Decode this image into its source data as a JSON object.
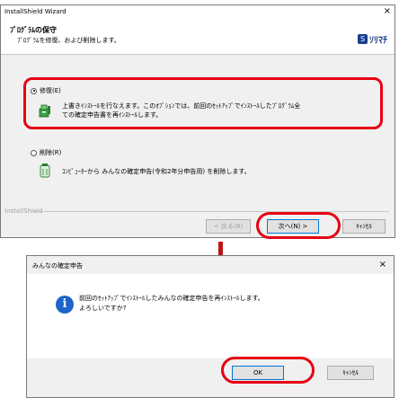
{
  "wizard": {
    "title": "InstallShield Wizard",
    "close_glyph": "×",
    "header_title": "ﾌﾟﾛｸﾞﾗﾑの保守",
    "header_subtitle": "ﾌﾟﾛｸﾞﾗﾑを修復、および削除します。",
    "logo_mark": "S",
    "logo_text": "ｿﾘﾏﾁ",
    "option_repair": {
      "label": "修復(E)",
      "selected": true,
      "desc_line1": "上書きｲﾝｽﾄｰﾙを行なえます。このｵﾌﾟｼｮﾝでは、前回のｾｯﾄｱｯﾌﾟでｲﾝｽﾄｰﾙしたﾌﾟﾛｸﾞﾗﾑ全",
      "desc_line2": "ての確定申告書を再ｲﾝｽﾄｰﾙします。",
      "icon": "setup-repair-icon"
    },
    "option_remove": {
      "label": "削除(R)",
      "selected": false,
      "desc": "ｺﾝﾋﾟｭｰﾀｰから みんなの確定申告(令和2年分申告用) を削除します。",
      "icon": "uninstall-icon"
    },
    "brand": "InstallShield",
    "buttons": {
      "back": "< 戻る(B)",
      "next": "次へ(N) >",
      "cancel": "ｷｬﾝｾﾙ"
    }
  },
  "dialog": {
    "title": "みんなの確定申告",
    "close_glyph": "×",
    "message_line1": "前回のｾｯﾄｱｯﾌﾟでｲﾝｽﾄｰﾙしたみんなの確定申告を再ｲﾝｽﾄｰﾙします。",
    "message_line2": "よろしいですか?",
    "icon": "info-icon",
    "icon_glyph": "i",
    "buttons": {
      "ok": "OK",
      "cancel": "ｷｬﾝｾﾙ"
    }
  },
  "colors": {
    "highlight": "#e60012",
    "arrow": "#c01414",
    "logo": "#1a3e8c",
    "info": "#1e64c8"
  }
}
